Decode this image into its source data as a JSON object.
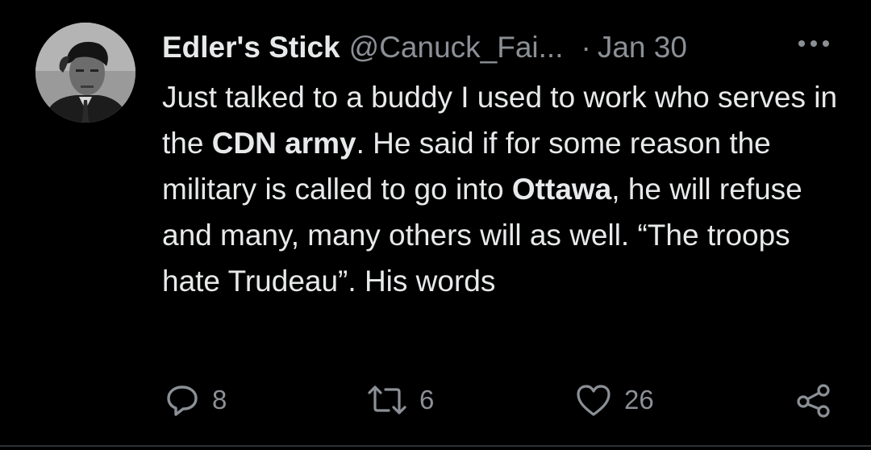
{
  "tweet": {
    "display_name": "Edler's Stick",
    "handle": "@Canuck_Fai...",
    "separator": "·",
    "date": "Jan 30",
    "body": {
      "seg1": "Just talked to a buddy I used to work who serves in the ",
      "bold1": "CDN army",
      "seg2": ". He said if for some reason the military is called to go into ",
      "bold2": "Ottawa",
      "seg3": ", he will refuse and many, many others will as well. “The troops hate Trudeau”. His words"
    },
    "actions": {
      "reply_count": "8",
      "retweet_count": "6",
      "like_count": "26"
    },
    "icons": {
      "more": "more-icon",
      "reply": "reply-icon",
      "retweet": "retweet-icon",
      "like": "heart-icon",
      "share": "share-icon"
    }
  },
  "colors": {
    "background": "#000000",
    "text_primary": "#e7e9ea",
    "text_secondary": "#8b9096",
    "divider": "#2f3336"
  }
}
